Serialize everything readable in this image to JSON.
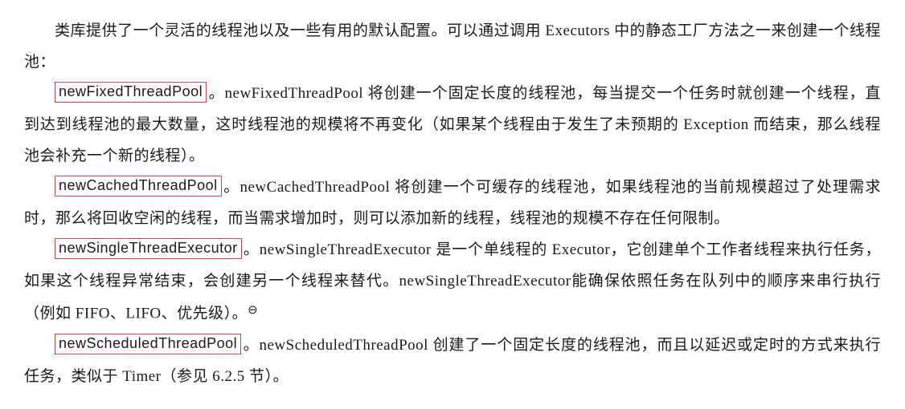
{
  "document": {
    "intro": {
      "line1_prefix_indent": "",
      "text": "类库提供了一个灵活的线程池以及一些有用的默认配置。可以通过调用 Executors 中的静态工厂方法之一来创建一个线程池："
    },
    "items": [
      {
        "term": "newFixedThreadPool",
        "desc": "。newFixedThreadPool 将创建一个固定长度的线程池，每当提交一个任务时就创建一个线程，直到达到线程池的最大数量，这时线程池的规模将不再变化（如果某个线程由于发生了未预期的 Exception 而结束，那么线程池会补充一个新的线程）。"
      },
      {
        "term": "newCachedThreadPool",
        "desc": "。newCachedThreadPool 将创建一个可缓存的线程池，如果线程池的当前规模超过了处理需求时，那么将回收空闲的线程，而当需求增加时，则可以添加新的线程，线程池的规模不存在任何限制。"
      },
      {
        "term": "newSingleThreadExecutor",
        "desc": "。newSingleThreadExecutor 是一个单线程的 Executor，它创建单个工作者线程来执行任务，如果这个线程异常结束，会创建另一个线程来替代。newSingleThreadExecutor能确保依照任务在队列中的顺序来串行执行（例如 FIFO、LIFO、优先级）。",
        "footnote_mark": "⊖"
      },
      {
        "term": "newScheduledThreadPool",
        "desc": "。newScheduledThreadPool 创建了一个固定长度的线程池，而且以延迟或定时的方式来执行任务，类似于 Timer（参见 6.2.5 节）。"
      }
    ]
  }
}
